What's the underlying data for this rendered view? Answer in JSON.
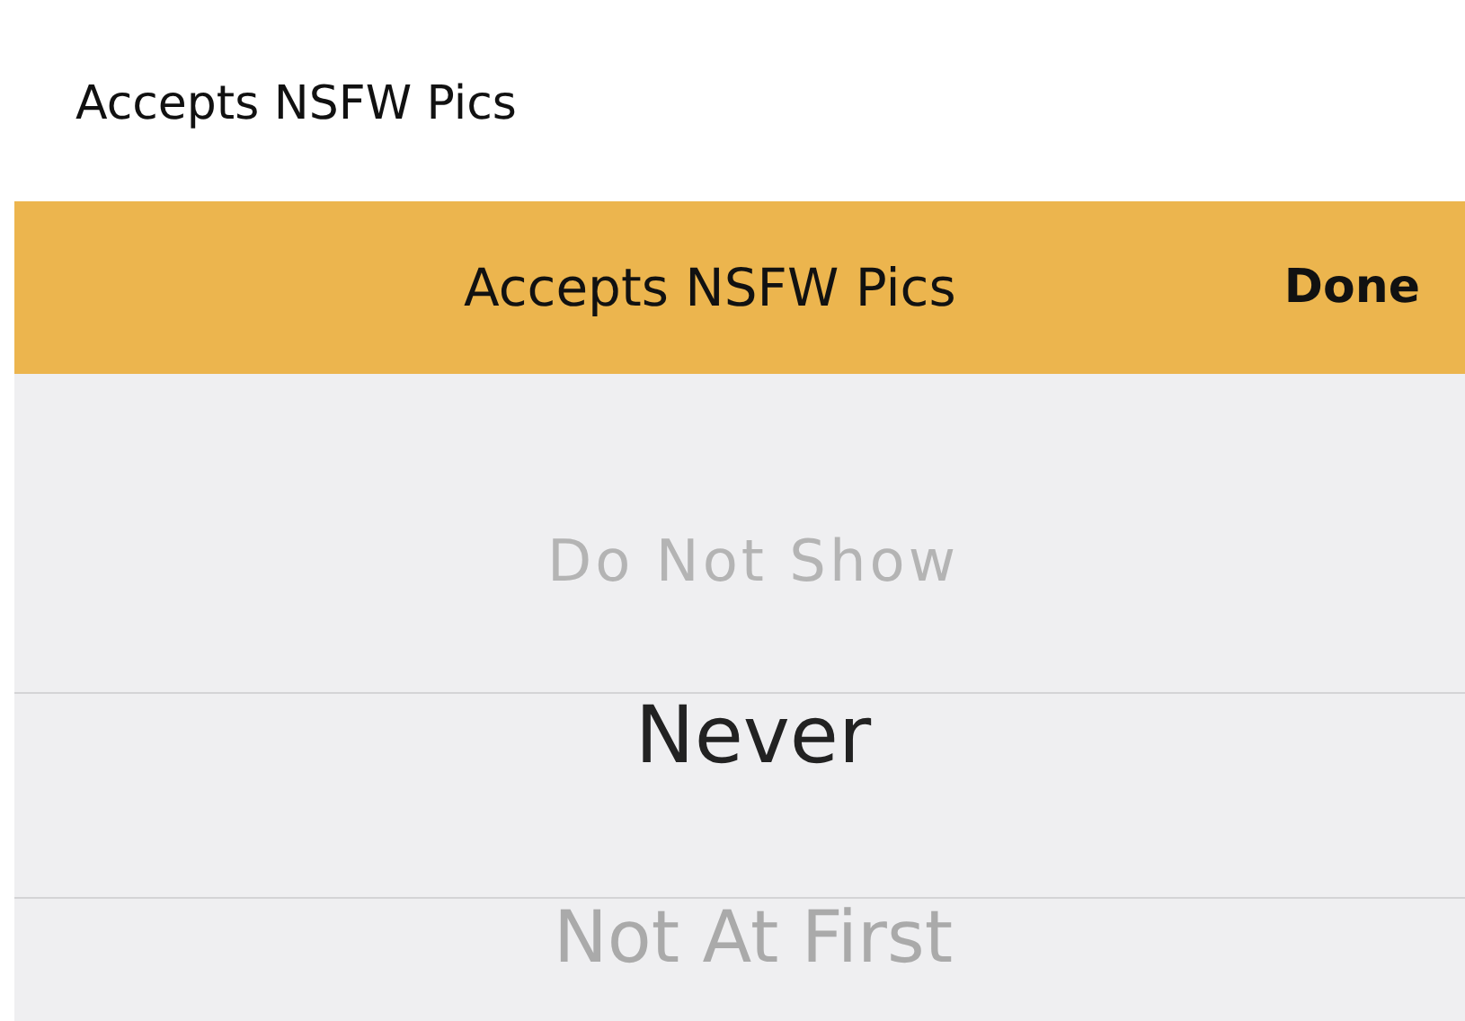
{
  "field": {
    "label": "Accepts NSFW Pics"
  },
  "toolbar": {
    "title": "Accepts NSFW Pics",
    "done": "Done"
  },
  "picker": {
    "options": [
      {
        "label": "Do Not Show",
        "selected": false
      },
      {
        "label": "Never",
        "selected": true
      },
      {
        "label": "Not At First",
        "selected": false
      }
    ]
  }
}
